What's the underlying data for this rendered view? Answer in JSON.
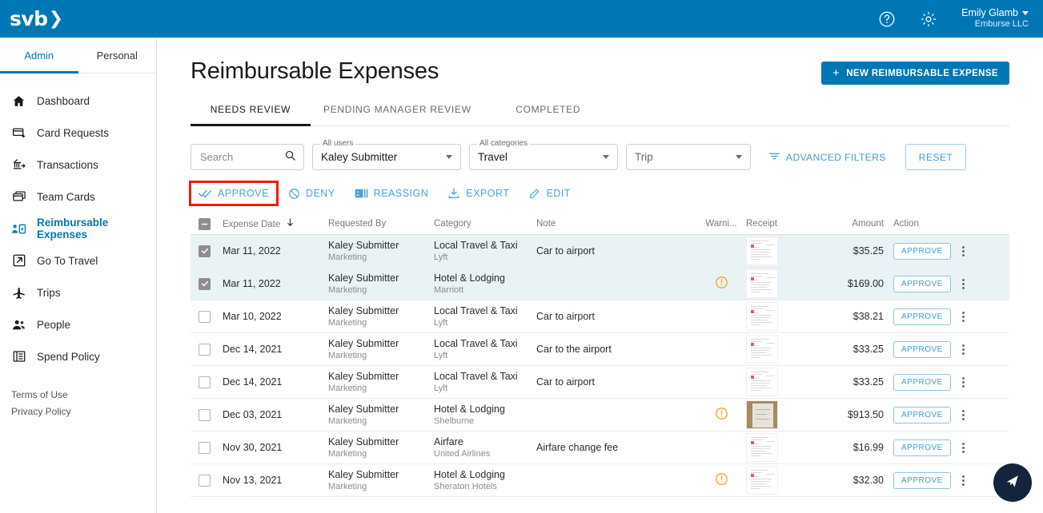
{
  "topbar": {
    "logo_text": "svb",
    "logo_chevron": "❯",
    "help_icon": "help-circle-icon",
    "settings_icon": "gear-icon",
    "user_name": "Emily Glamb",
    "user_org": "Emburse LLC"
  },
  "sidebar": {
    "subtabs": [
      {
        "label": "Admin",
        "active": true
      },
      {
        "label": "Personal",
        "active": false
      }
    ],
    "items": [
      {
        "label": "Dashboard",
        "icon": "home-icon",
        "active": false
      },
      {
        "label": "Card Requests",
        "icon": "card-plus-icon",
        "active": false
      },
      {
        "label": "Transactions",
        "icon": "bank-transfer-icon",
        "active": false
      },
      {
        "label": "Team Cards",
        "icon": "cards-stack-icon",
        "active": false
      },
      {
        "label": "Reimbursable Expenses",
        "icon": "person-card-icon",
        "active": true
      },
      {
        "label": "Go To Travel",
        "icon": "external-link-icon",
        "active": false
      },
      {
        "label": "Trips",
        "icon": "airplane-icon",
        "active": false
      },
      {
        "label": "People",
        "icon": "people-icon",
        "active": false
      },
      {
        "label": "Spend Policy",
        "icon": "policy-list-icon",
        "active": false
      }
    ],
    "legal": [
      "Terms of Use",
      "Privacy Policy"
    ]
  },
  "page": {
    "title": "Reimbursable Expenses",
    "new_button": "NEW REIMBURSABLE EXPENSE",
    "new_button_plus": "+"
  },
  "tabs": [
    {
      "label": "NEEDS REVIEW",
      "active": true
    },
    {
      "label": "PENDING MANAGER REVIEW",
      "active": false
    },
    {
      "label": "COMPLETED",
      "active": false
    }
  ],
  "filters": {
    "search_placeholder": "Search",
    "search_value": "",
    "search_icon": "search-icon",
    "users": {
      "label": "All users",
      "value": "Kaley Submitter"
    },
    "categories": {
      "label": "All categories",
      "value": "Travel"
    },
    "trip": {
      "label": "",
      "value": "Trip"
    },
    "advanced_filters": "ADVANCED FILTERS",
    "reset": "RESET"
  },
  "actions": [
    {
      "label": "APPROVE",
      "icon": "double-check-icon",
      "highlighted": true
    },
    {
      "label": "DENY",
      "icon": "block-circle-icon",
      "highlighted": false
    },
    {
      "label": "REASSIGN",
      "icon": "reassign-card-icon",
      "highlighted": false
    },
    {
      "label": "EXPORT",
      "icon": "download-icon",
      "highlighted": false
    },
    {
      "label": "EDIT",
      "icon": "pencil-icon",
      "highlighted": false
    }
  ],
  "table": {
    "select_all_state": "indeterminate",
    "columns": [
      "Expense Date",
      "Requested By",
      "Category",
      "Note",
      "Warni...",
      "Receipt",
      "Amount",
      "Action"
    ],
    "sort_column": "Expense Date",
    "sort_direction": "descending",
    "row_action_label": "APPROVE",
    "rows": [
      {
        "selected": true,
        "date": "Mar 11, 2022",
        "requested_by": "Kaley Submitter",
        "department": "Marketing",
        "category": "Local Travel & Taxi",
        "merchant": "Lyft",
        "note": "Car to airport",
        "warning": false,
        "receipt": "document",
        "amount": "$35.25"
      },
      {
        "selected": true,
        "date": "Mar 11, 2022",
        "requested_by": "Kaley Submitter",
        "department": "Marketing",
        "category": "Hotel & Lodging",
        "merchant": "Marriott",
        "note": "",
        "warning": true,
        "receipt": "document",
        "amount": "$169.00"
      },
      {
        "selected": false,
        "date": "Mar 10, 2022",
        "requested_by": "Kaley Submitter",
        "department": "Marketing",
        "category": "Local Travel & Taxi",
        "merchant": "Lyft",
        "note": "Car to airport",
        "warning": false,
        "receipt": "document",
        "amount": "$38.21"
      },
      {
        "selected": false,
        "date": "Dec 14, 2021",
        "requested_by": "Kaley Submitter",
        "department": "Marketing",
        "category": "Local Travel & Taxi",
        "merchant": "Lyft",
        "note": "Car to the airport",
        "warning": false,
        "receipt": "document",
        "amount": "$33.25"
      },
      {
        "selected": false,
        "date": "Dec 14, 2021",
        "requested_by": "Kaley Submitter",
        "department": "Marketing",
        "category": "Local Travel & Taxi",
        "merchant": "Lyft",
        "note": "Car to airport",
        "warning": false,
        "receipt": "document",
        "amount": "$33.25"
      },
      {
        "selected": false,
        "date": "Dec 03, 2021",
        "requested_by": "Kaley Submitter",
        "department": "Marketing",
        "category": "Hotel & Lodging",
        "merchant": "Shelburne",
        "note": "",
        "warning": true,
        "receipt": "photo",
        "amount": "$913.50"
      },
      {
        "selected": false,
        "date": "Nov 30, 2021",
        "requested_by": "Kaley Submitter",
        "department": "Marketing",
        "category": "Airfare",
        "merchant": "United Airlines",
        "note": "Airfare change fee",
        "warning": false,
        "receipt": "document",
        "amount": "$16.99"
      },
      {
        "selected": false,
        "date": "Nov 13, 2021",
        "requested_by": "Kaley Submitter",
        "department": "Marketing",
        "category": "Hotel & Lodging",
        "merchant": "Sheraton Hotels",
        "note": "",
        "warning": true,
        "receipt": "document",
        "amount": "$32.30"
      }
    ]
  },
  "fab": {
    "icon": "send-arrow-icon"
  },
  "colors": {
    "brand_blue": "#0077b5",
    "link_blue": "#3f9dd0",
    "warning_orange": "#f5a623",
    "highlight_red": "#f01d00",
    "selected_row": "#e9f2f5",
    "fab_navy": "#14243d"
  }
}
